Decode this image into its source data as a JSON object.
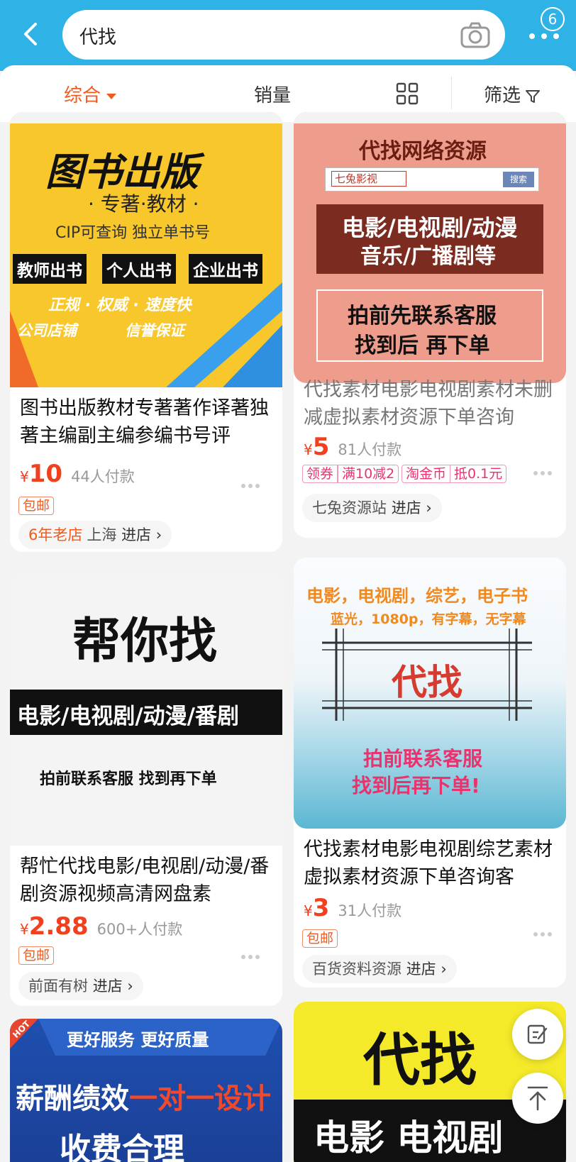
{
  "header": {
    "search_query": "代找",
    "badge_count": "6"
  },
  "sort_bar": {
    "tab_comprehensive": "综合",
    "tab_sales": "销量",
    "tab_filter": "筛选"
  },
  "products": [
    {
      "banner": {
        "line1": "图书出版",
        "line2": "· 专著·教材 ·",
        "line3": "CIP可查询  独立单书号",
        "label1": "教师出书",
        "label2": "个人出书",
        "label3": "企业出书",
        "line4": "正规 · 权威 · 速度快",
        "line5": "公司店铺",
        "line6": "信誉保证"
      },
      "title": "图书出版教材专著著作译著独著主编副主编参编书号评",
      "yen": "¥",
      "price": "10",
      "paid": "44人付款",
      "tags": [
        "包邮"
      ],
      "shop_badge": "6年老店",
      "shop_name": "上海",
      "enter_label": "进店 ›"
    },
    {
      "banner": {
        "line1": "代找网络资源",
        "search_sample": "七兔影视",
        "search_btn": "搜索",
        "box_line1": "电影/电视剧/动漫",
        "box_line2": "音乐/广播剧等",
        "note1": "拍前先联系客服",
        "note2": "找到后  再下单"
      },
      "title": "代找素材电影电视剧素材未删减虚拟素材资源下单咨询",
      "yen": "¥",
      "price": "5",
      "paid": "81人付款",
      "tags": [
        "领券",
        "满10减2",
        "淘金币",
        "抵0.1元"
      ],
      "shop_name": "七兔资源站",
      "enter_label": "进店 ›"
    },
    {
      "banner": {
        "line1": "帮你找",
        "line2": "电影/电视剧/动漫/番剧",
        "line3": "拍前联系客服    找到再下单"
      },
      "title": "帮忙代找电影/电视剧/动漫/番剧资源视频高清网盘素",
      "yen": "¥",
      "price": "2.88",
      "paid": "600+人付款",
      "tags": [
        "包邮"
      ],
      "shop_name": "前面有树",
      "enter_label": "进店 ›"
    },
    {
      "banner": {
        "line1": "电影，电视剧，综艺，电子书",
        "line2": "蓝光，1080p，有字幕，无字幕",
        "line3": "代找",
        "line4": "拍前联系客服",
        "line5": "找到后再下单!"
      },
      "title": "代找素材电影电视剧综艺素材虚拟素材资源下单咨询客",
      "yen": "¥",
      "price": "3",
      "paid": "31人付款",
      "tags": [
        "包邮"
      ],
      "shop_name": "百货资料资源",
      "enter_label": "进店 ›"
    },
    {
      "banner": {
        "hot": "HOT",
        "line1": "更好服务 更好质量",
        "line2a": "薪酬绩效",
        "line2b": "一对一设计",
        "line3": "收费合理"
      }
    },
    {
      "banner": {
        "line1": "代找",
        "line2": "电影  电视剧"
      }
    }
  ],
  "colors": {
    "brand_blue": "#2fb3e6",
    "accent_orange": "#f05a1e",
    "price_red": "#f0401e"
  },
  "icons": [
    "back-icon",
    "camera-icon",
    "more-icon",
    "grid-icon",
    "filter-icon",
    "dots-icon",
    "feedback-icon",
    "back-to-top-icon"
  ]
}
